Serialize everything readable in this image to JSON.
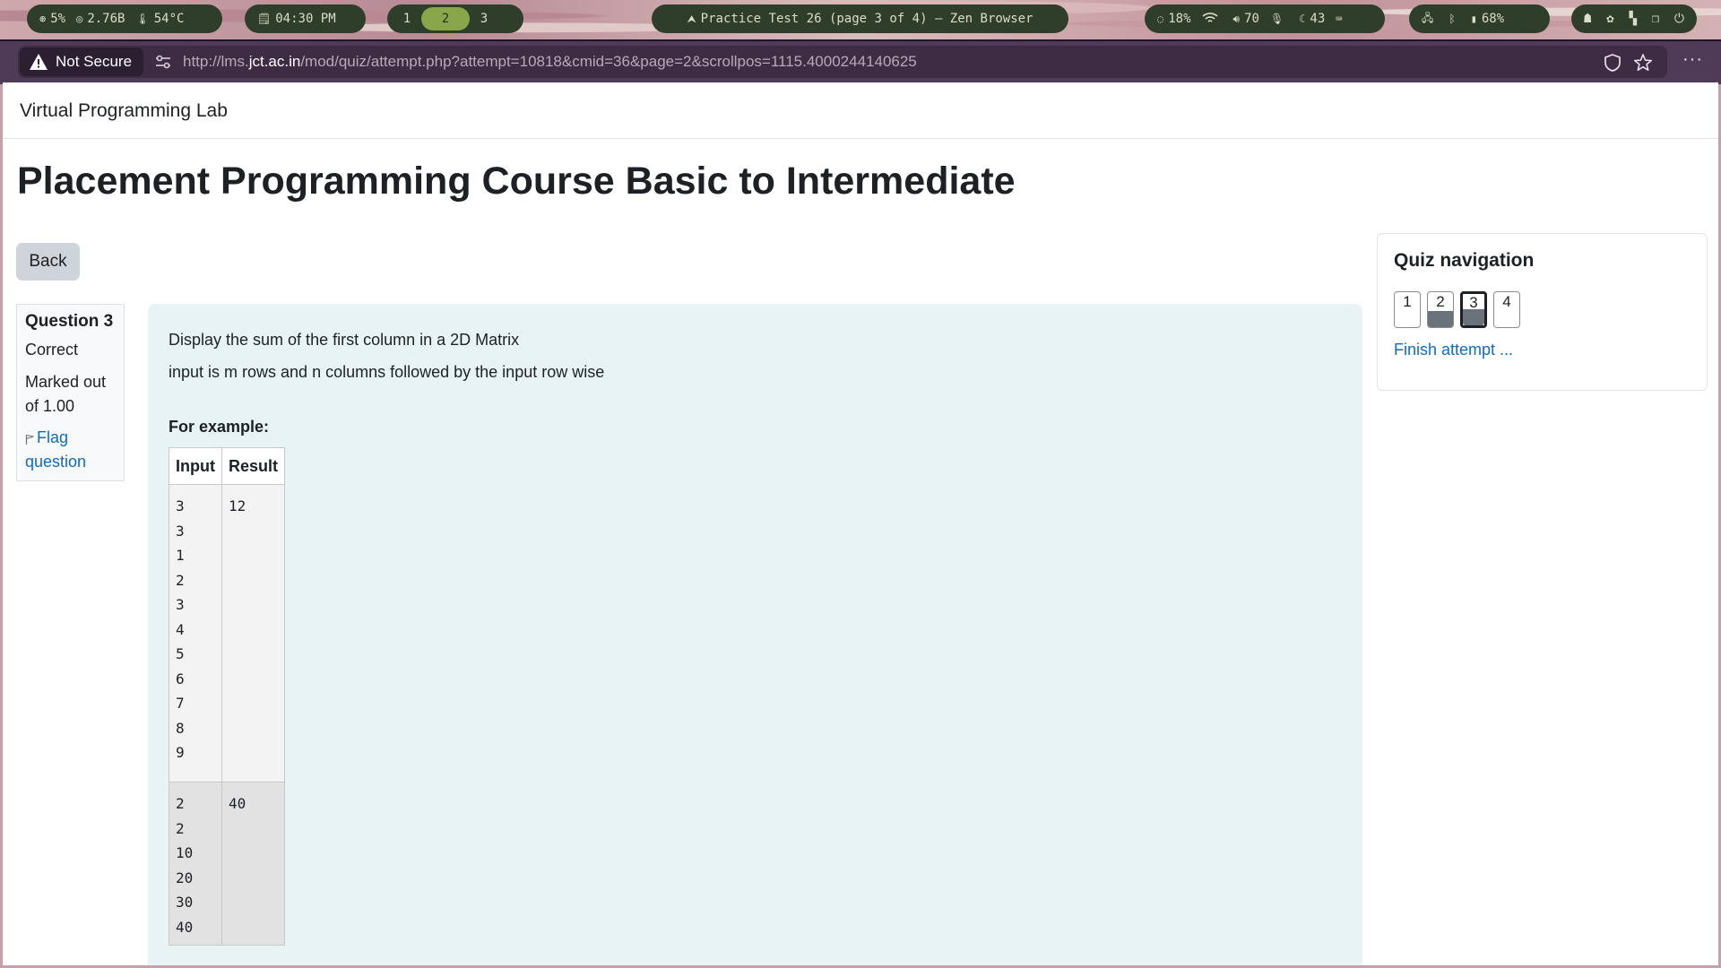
{
  "panel": {
    "cpu": "5%",
    "mem": "2.76B",
    "temp": "54°C",
    "clock": "04:30 PM",
    "workspaces": [
      "1",
      "2",
      "3"
    ],
    "active_workspace": "2",
    "window_title": "Practice Test 26 (page 3 of 4) — Zen Browser",
    "brightness": "18%",
    "volume": "70",
    "night": "43",
    "battery": "68%"
  },
  "browser": {
    "security_label": "Not Secure",
    "url_prefix": "http://lms.",
    "url_domain": "jct.ac.in",
    "url_path": "/mod/quiz/attempt.php?attempt=10818&cmid=36&page=2&scrollpos=1115.4000244140625",
    "menu_label": "···"
  },
  "page": {
    "site_name": "Virtual Programming Lab",
    "course_title": "Placement Programming Course Basic to Intermediate",
    "back_label": "Back"
  },
  "question_info": {
    "number_label": "Question 3",
    "state": "Correct",
    "grade_line1": "Marked out",
    "grade_line2": "of 1.00",
    "flag_line1": "Flag",
    "flag_line2": "question"
  },
  "question": {
    "line1": "Display the sum of the first column in a 2D Matrix",
    "line2": "input is m rows and n columns followed by the input row wise",
    "example_heading": "For example:",
    "table_headers": [
      "Input",
      "Result"
    ],
    "examples": [
      {
        "input": [
          "3",
          "3",
          "1",
          "2",
          "3",
          "4",
          "5",
          "6",
          "7",
          "8",
          "9"
        ],
        "result": "12"
      },
      {
        "input": [
          "2",
          "2",
          "10",
          "20",
          "30",
          "40"
        ],
        "result": "40"
      }
    ]
  },
  "quiz_nav": {
    "title": "Quiz navigation",
    "buttons": [
      {
        "label": "1",
        "answered": false,
        "current": false
      },
      {
        "label": "2",
        "answered": true,
        "current": false
      },
      {
        "label": "3",
        "answered": true,
        "current": true
      },
      {
        "label": "4",
        "answered": false,
        "current": false
      }
    ],
    "finish_label": "Finish attempt ..."
  }
}
